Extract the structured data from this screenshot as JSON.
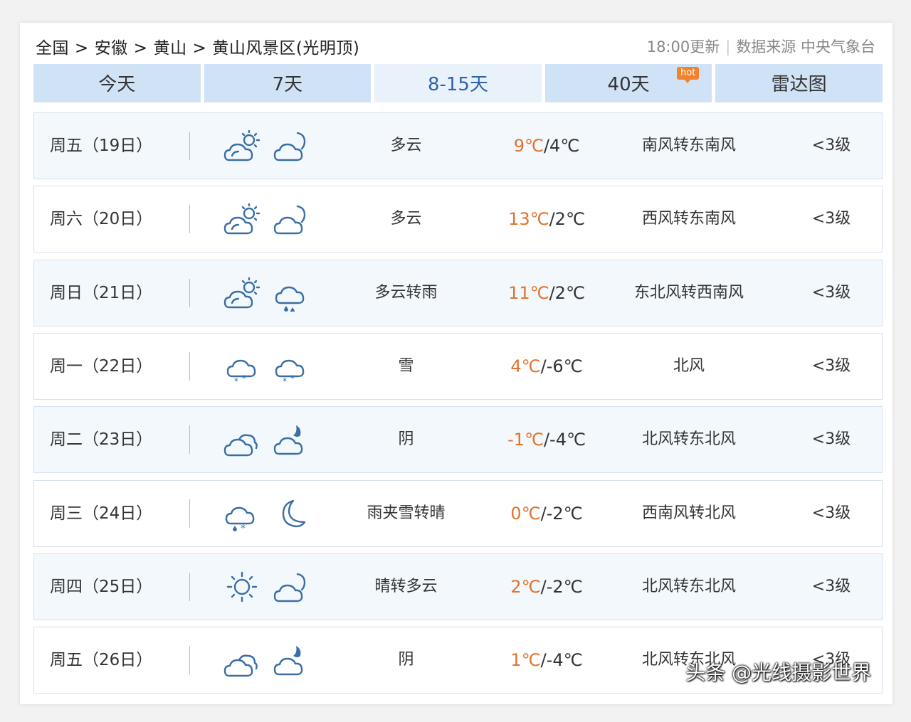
{
  "breadcrumb": [
    "全国",
    "安徽",
    "黄山",
    "黄山风景区(光明顶)"
  ],
  "breadcrumb_sep": ">",
  "update": {
    "time": "18:00更新",
    "source": "数据来源 中央气象台"
  },
  "tabs": [
    {
      "label": "今天"
    },
    {
      "label": "7天"
    },
    {
      "label": "8-15天"
    },
    {
      "label": "40天",
      "badge": "hot"
    },
    {
      "label": "雷达图"
    }
  ],
  "active_tab": "8-15天",
  "forecast": [
    {
      "day": "周五（19日）",
      "icon_day": "partly-cloudy-day-icon",
      "icon_night": "partly-cloudy-night-icon",
      "desc": "多云",
      "high": "9℃",
      "low": "/4℃",
      "wind": "南风转东南风",
      "level": "<3级"
    },
    {
      "day": "周六（20日）",
      "icon_day": "partly-cloudy-day-icon",
      "icon_night": "partly-cloudy-night-icon",
      "desc": "多云",
      "high": "13℃",
      "low": "/2℃",
      "wind": "西风转东南风",
      "level": "<3级"
    },
    {
      "day": "周日（21日）",
      "icon_day": "partly-cloudy-day-icon",
      "icon_night": "rain-icon",
      "desc": "多云转雨",
      "high": "11℃",
      "low": "/2℃",
      "wind": "东北风转西南风",
      "level": "<3级"
    },
    {
      "day": "周一（22日）",
      "icon_day": "snow-icon",
      "icon_night": "snow-icon",
      "desc": "雪",
      "high": "4℃",
      "low": "/-6℃",
      "wind": "北风",
      "level": "<3级"
    },
    {
      "day": "周二（23日）",
      "icon_day": "overcast-icon",
      "icon_night": "overcast-night-icon",
      "desc": "阴",
      "high": "-1℃",
      "low": "/-4℃",
      "wind": "北风转东北风",
      "level": "<3级"
    },
    {
      "day": "周三（24日）",
      "icon_day": "sleet-icon",
      "icon_night": "moon-icon",
      "desc": "雨夹雪转晴",
      "high": "0℃",
      "low": "/-2℃",
      "wind": "西南风转北风",
      "level": "<3级"
    },
    {
      "day": "周四（25日）",
      "icon_day": "sun-icon",
      "icon_night": "partly-cloudy-night-icon",
      "desc": "晴转多云",
      "high": "2℃",
      "low": "/-2℃",
      "wind": "北风转东北风",
      "level": "<3级"
    },
    {
      "day": "周五（26日）",
      "icon_day": "overcast-icon",
      "icon_night": "overcast-night-icon",
      "desc": "阴",
      "high": "1℃",
      "low": "/-4℃",
      "wind": "北风转东北风",
      "level": "<3级"
    }
  ],
  "watermark": "头条 @光线摄影世界",
  "colors": {
    "tab_bg": "#cfe2f6",
    "tab_active": "#2d63a8",
    "high_temp": "#e2732c",
    "icon": "#3a6ea5",
    "hot_badge": "#f3822c"
  }
}
